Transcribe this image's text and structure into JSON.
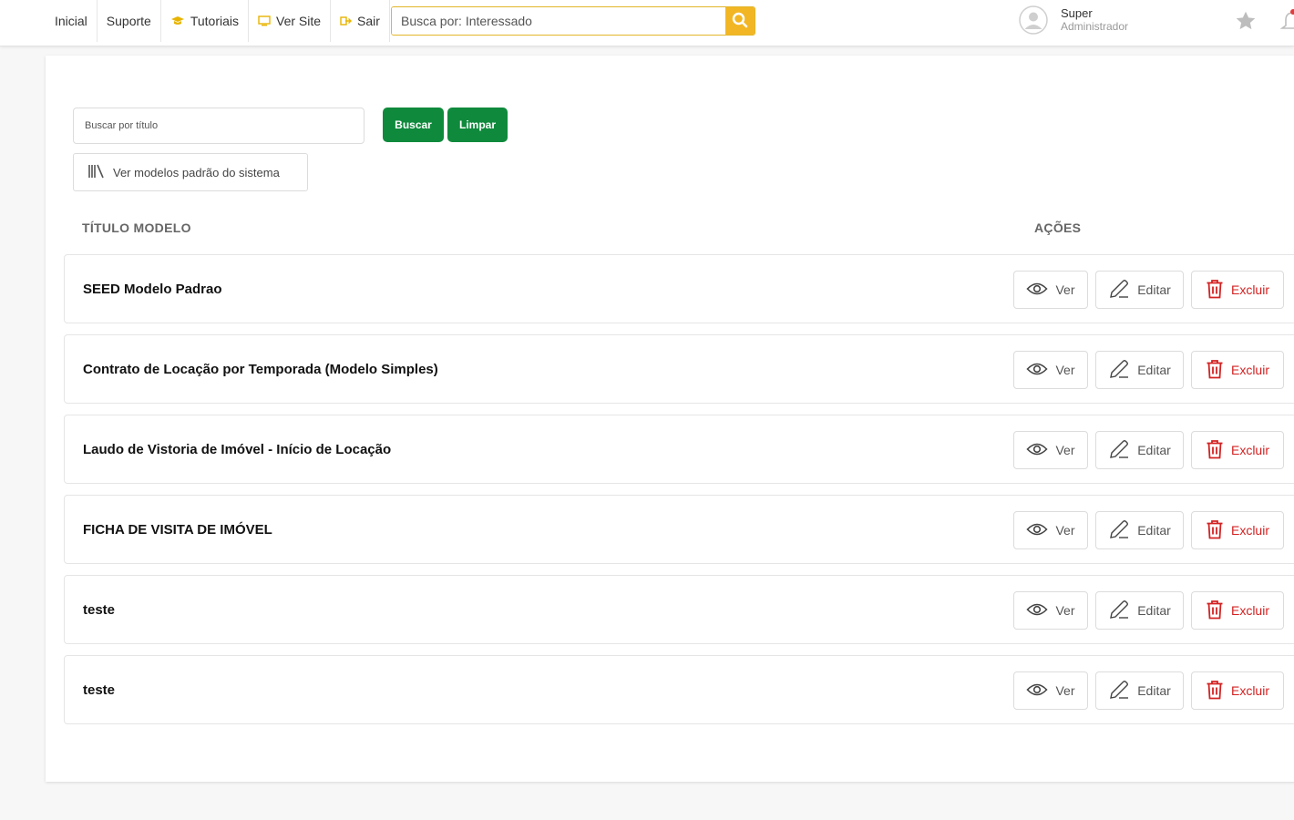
{
  "topbar": {
    "nav": [
      {
        "label": "Inicial",
        "icon": ""
      },
      {
        "label": "Suporte",
        "icon": ""
      },
      {
        "label": "Tutoriais",
        "icon": "graduation-cap-icon"
      },
      {
        "label": "Ver Site",
        "icon": "monitor-icon"
      },
      {
        "label": "Sair",
        "icon": "sign-out-icon"
      }
    ],
    "search_placeholder": "Busca por: Interessado",
    "user_name": "Super",
    "user_role": "Administrador"
  },
  "filters": {
    "title_placeholder": "Buscar por título",
    "buscar_label": "Buscar",
    "limpar_label": "Limpar",
    "models_label": "Ver modelos padrão do sistema"
  },
  "table": {
    "col_title": "TÍTULO MODELO",
    "col_actions": "AÇÕES",
    "action_labels": {
      "view": "Ver",
      "edit": "Editar",
      "delete": "Excluir"
    },
    "rows": [
      {
        "title": "SEED Modelo Padrao"
      },
      {
        "title": "Contrato de Locação por Temporada (Modelo Simples)"
      },
      {
        "title": "Laudo de Vistoria de Imóvel - Início de Locação"
      },
      {
        "title": "FICHA DE VISITA DE IMÓVEL"
      },
      {
        "title": "teste"
      },
      {
        "title": "teste"
      }
    ]
  },
  "colors": {
    "accent_yellow": "#f2b624",
    "primary_green": "#0f8a3c",
    "danger_red": "#d32222"
  }
}
